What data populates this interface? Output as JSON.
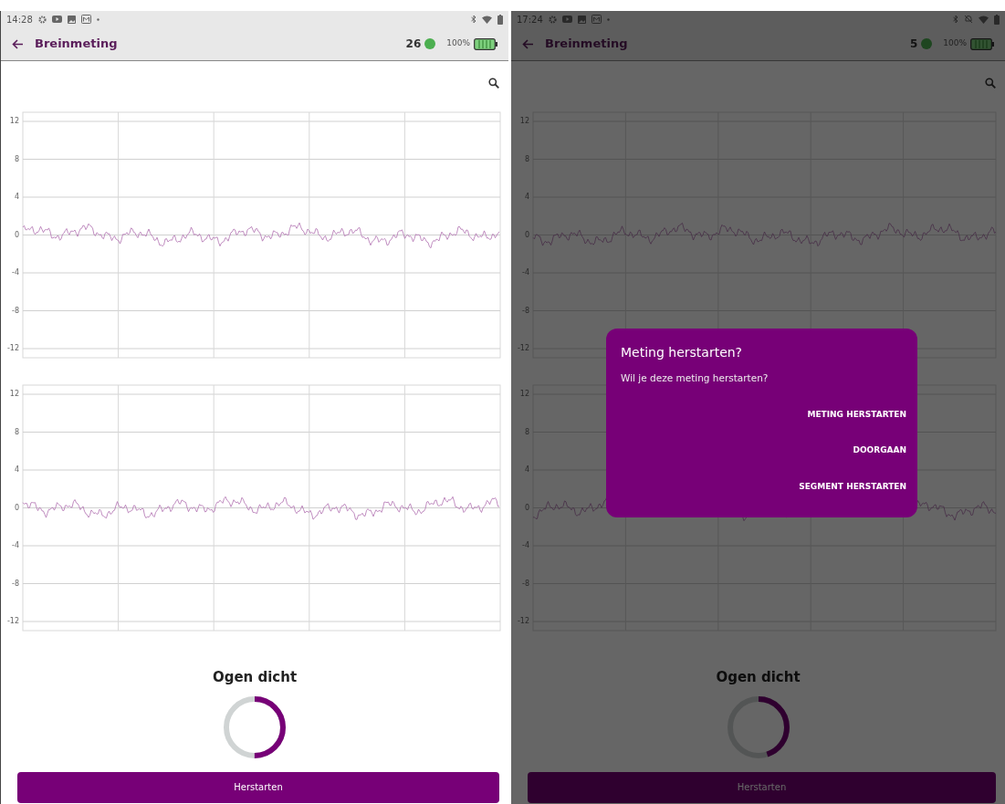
{
  "screens": [
    {
      "dimmed": false,
      "status_bar": {
        "time": "14:28",
        "silent_mode": false
      },
      "app_bar": {
        "title": "Breinmeting",
        "count": "26",
        "battery": "100%"
      },
      "charts": [
        {
          "y_ticks": [
            "12",
            "8",
            "4",
            "0",
            "-4",
            "-8",
            "-12"
          ]
        },
        {
          "y_ticks": [
            "12",
            "8",
            "4",
            "0",
            "-4",
            "-8",
            "-12"
          ]
        }
      ],
      "caption": "Ogen dicht",
      "progress": {
        "level": 0.5
      },
      "button": "Herstarten"
    },
    {
      "dimmed": true,
      "status_bar": {
        "time": "17:24",
        "silent_mode": true
      },
      "app_bar": {
        "title": "Breinmeting",
        "count": "5",
        "battery": "100%"
      },
      "charts": [
        {
          "y_ticks": [
            "12",
            "8",
            "4",
            "0",
            "-4",
            "-8",
            "-12"
          ]
        },
        {
          "y_ticks": [
            "12",
            "8",
            "4",
            "0",
            "-4",
            "-8",
            "-12"
          ]
        }
      ],
      "caption": "Ogen dicht",
      "progress": {
        "level": 0.45
      },
      "button": "Herstarten",
      "dialog": {
        "title": "Meting herstarten?",
        "message": "Wil je deze meting herstarten?",
        "actions": [
          "METING HERSTARTEN",
          "DOORGAAN",
          "SEGMENT HERSTARTEN"
        ]
      }
    }
  ]
}
